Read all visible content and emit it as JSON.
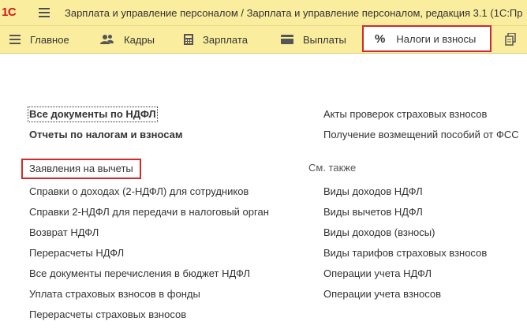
{
  "window": {
    "logo_text": "1С",
    "title": "Зарплата и управление персоналом / Зарплата и управление персоналом, редакция 3.1  (1С:Пр"
  },
  "sections": [
    {
      "label": "Главное",
      "icon": "menu-lines-icon"
    },
    {
      "label": "Кадры",
      "icon": "people-icon"
    },
    {
      "label": "Зарплата",
      "icon": "calculator-icon"
    },
    {
      "label": "Выплаты",
      "icon": "card-icon"
    },
    {
      "label": "Налоги и взносы",
      "icon": "percent-icon",
      "active": true,
      "icon_glyph": "%"
    }
  ],
  "left_column": {
    "links_top": [
      {
        "label": "Все документы по НДФЛ",
        "bold": true
      },
      {
        "label": "Отчеты по налогам и взносам",
        "bold": true
      }
    ],
    "links": [
      {
        "label": "Заявления на вычеты",
        "highlighted": true
      },
      {
        "label": "Справки о доходах (2-НДФЛ) для сотрудников"
      },
      {
        "label": "Справки 2-НДФЛ для передачи в налоговый орган"
      },
      {
        "label": "Возврат НДФЛ"
      },
      {
        "label": "Перерасчеты НДФЛ"
      },
      {
        "label": "Все документы перечисления в бюджет НДФЛ"
      },
      {
        "label": "Уплата страховых взносов в фонды"
      },
      {
        "label": "Перерасчеты страховых взносов"
      }
    ]
  },
  "right_column": {
    "links_top": [
      {
        "label": "Акты проверок страховых взносов"
      },
      {
        "label": "Получение возмещений пособий от ФСС"
      }
    ],
    "see_also_heading": "См. также",
    "see_also": [
      {
        "label": "Виды доходов НДФЛ"
      },
      {
        "label": "Виды вычетов НДФЛ"
      },
      {
        "label": "Виды доходов (взносы)"
      },
      {
        "label": "Виды тарифов страховых взносов"
      },
      {
        "label": "Операции учета НДФЛ"
      },
      {
        "label": "Операции учета взносов"
      }
    ]
  },
  "colors": {
    "toolbar_bg": "#fbed9e",
    "highlight_border": "#d12a2a",
    "logo": "#d01919"
  }
}
